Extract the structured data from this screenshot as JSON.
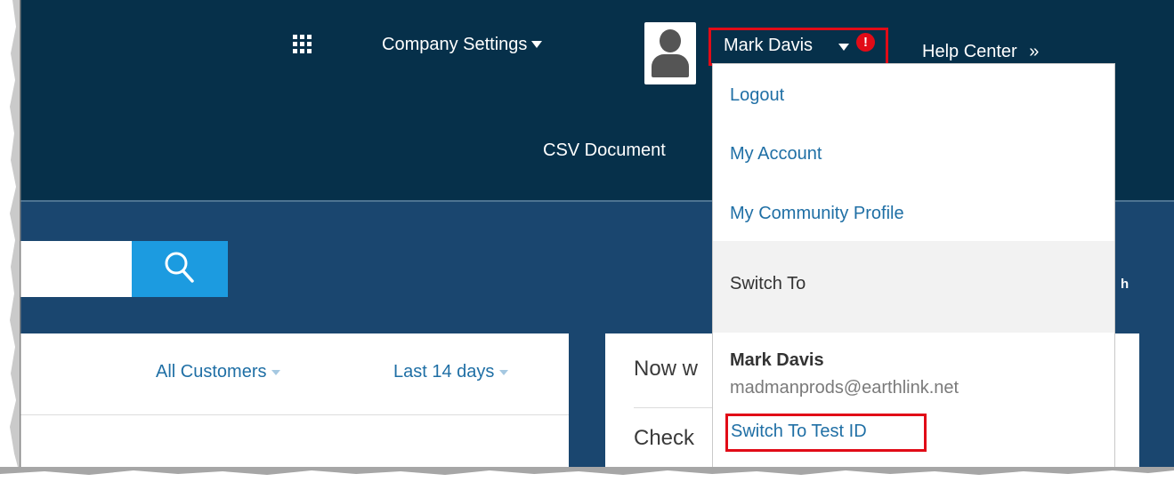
{
  "header": {
    "company_settings_label": "Company Settings",
    "user_name": "Mark Davis",
    "alert_glyph": "!",
    "help_center_label": "Help Center",
    "help_center_glyph": "»",
    "csv_documents_label": "CSV Document"
  },
  "search": {
    "placeholder": "",
    "button_icon": "search-icon",
    "right_stub_text": "h"
  },
  "filters": {
    "customers_label": "All Customers",
    "period_label": "Last 14 days"
  },
  "right_card": {
    "line1": "Now w",
    "line2": "Check"
  },
  "user_dropdown": {
    "logout": "Logout",
    "my_account": "My Account",
    "my_community_profile": "My Community Profile",
    "switch_to_label": "Switch To",
    "account_name": "Mark Davis",
    "account_email": "madmanprods@earthlink.net",
    "switch_to_test_id": "Switch To Test ID"
  },
  "colors": {
    "header_bg": "#06304a",
    "main_bg": "#1a466f",
    "accent_blue": "#1c9be0",
    "link_blue": "#1f6fa5",
    "highlight_red": "#e10b17"
  }
}
